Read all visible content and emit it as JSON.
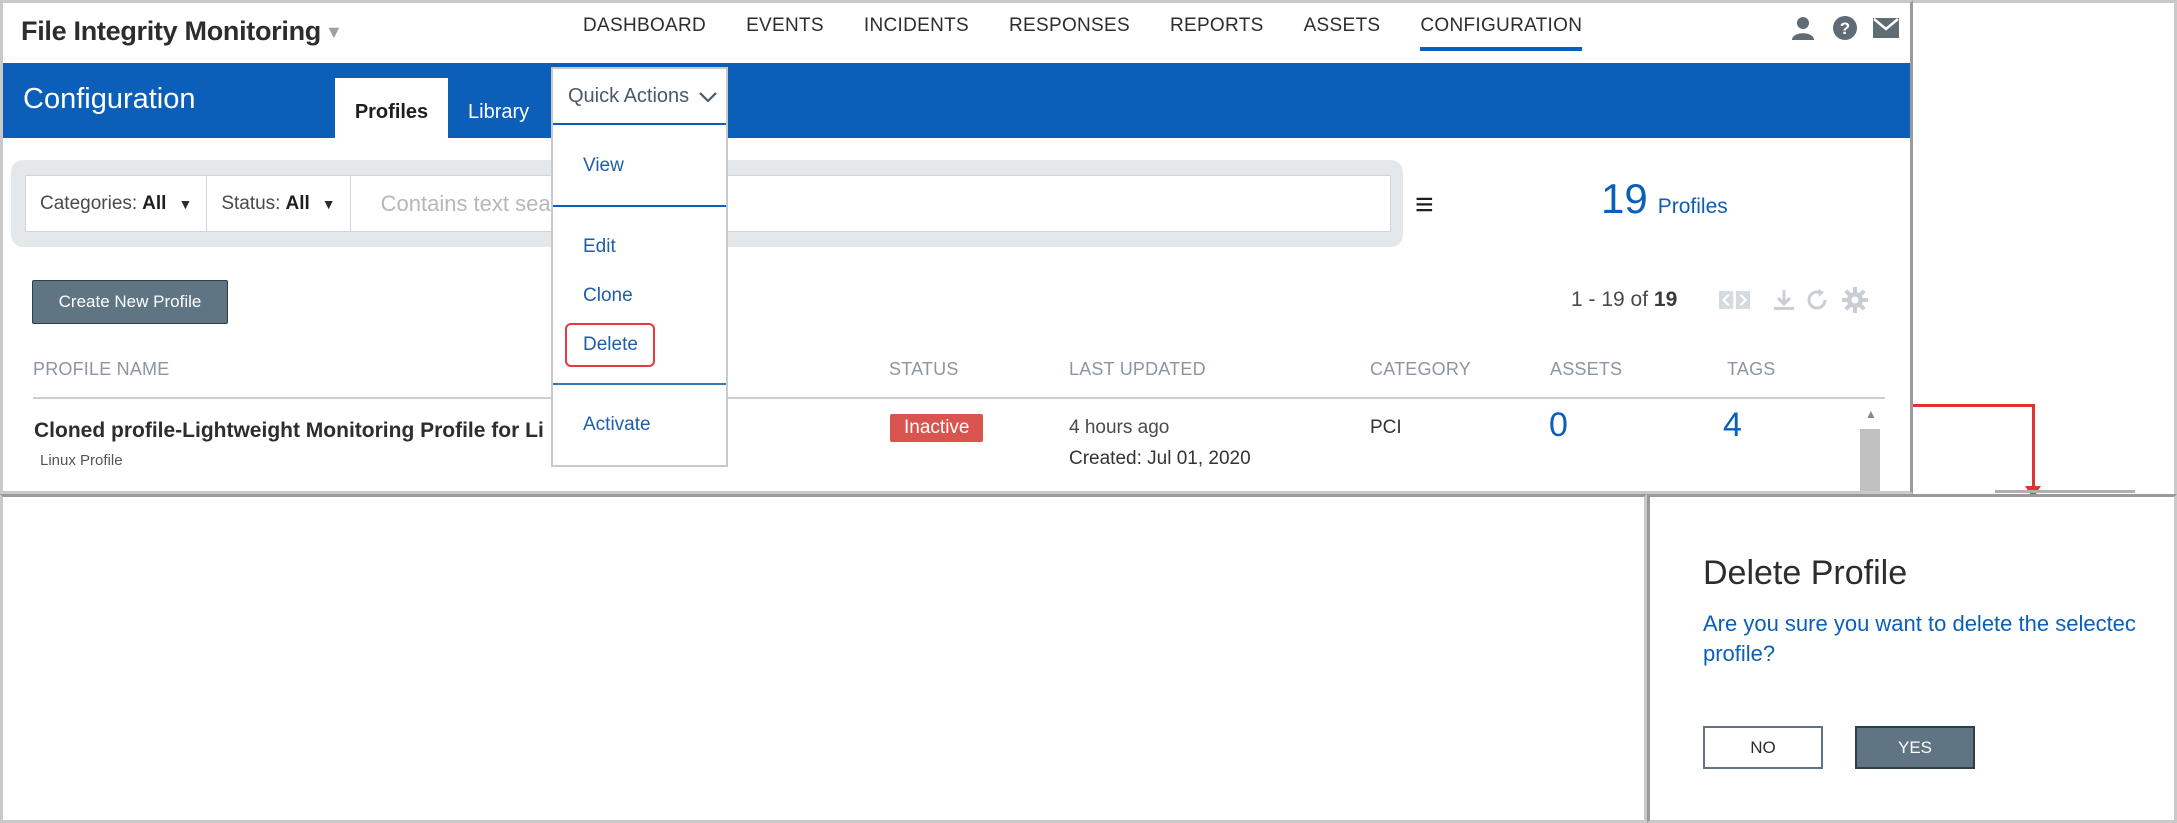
{
  "header": {
    "app_title": "File Integrity Monitoring",
    "nav": [
      "DASHBOARD",
      "EVENTS",
      "INCIDENTS",
      "RESPONSES",
      "REPORTS",
      "ASSETS",
      "CONFIGURATION"
    ],
    "active_nav": "CONFIGURATION",
    "icons": [
      "user-icon",
      "help-icon",
      "mail-icon"
    ]
  },
  "config": {
    "title": "Configuration",
    "tabs": [
      "Profiles",
      "Library"
    ],
    "active_tab": "Profiles"
  },
  "quick_actions": {
    "label": "Quick Actions",
    "items": [
      "View",
      "Edit",
      "Clone",
      "Delete",
      "Activate"
    ],
    "highlighted": "Delete"
  },
  "filters": {
    "categories_label": "Categories:",
    "categories_value": "All",
    "status_label": "Status:",
    "status_value": "All",
    "search_placeholder": "Contains text search"
  },
  "summary": {
    "count": "19",
    "count_label": "Profiles"
  },
  "toolbar": {
    "create_label": "Create New Profile",
    "pager_range": "1 - 19 of",
    "pager_total": "19"
  },
  "table": {
    "columns": [
      "PROFILE NAME",
      "STATUS",
      "LAST UPDATED",
      "CATEGORY",
      "ASSETS",
      "TAGS"
    ],
    "rows": [
      {
        "name": "Cloned profile-Lightweight Monitoring Profile for Li",
        "subtitle": "Linux Profile",
        "status": "Inactive",
        "last_updated": "4 hours ago",
        "created": "Created: Jul 01, 2020",
        "category": "PCI",
        "assets": "0",
        "tags": "4"
      }
    ]
  },
  "dialog": {
    "title": "Delete Profile",
    "message_line1": "Are you sure you want to delete the selectec",
    "message_line2": "profile?",
    "no_label": "NO",
    "yes_label": "YES"
  },
  "colors": {
    "brand_blue": "#0b5fb9",
    "button_slate": "#5f7584",
    "status_inactive": "#d9534f",
    "highlight_red": "#e5393d"
  }
}
